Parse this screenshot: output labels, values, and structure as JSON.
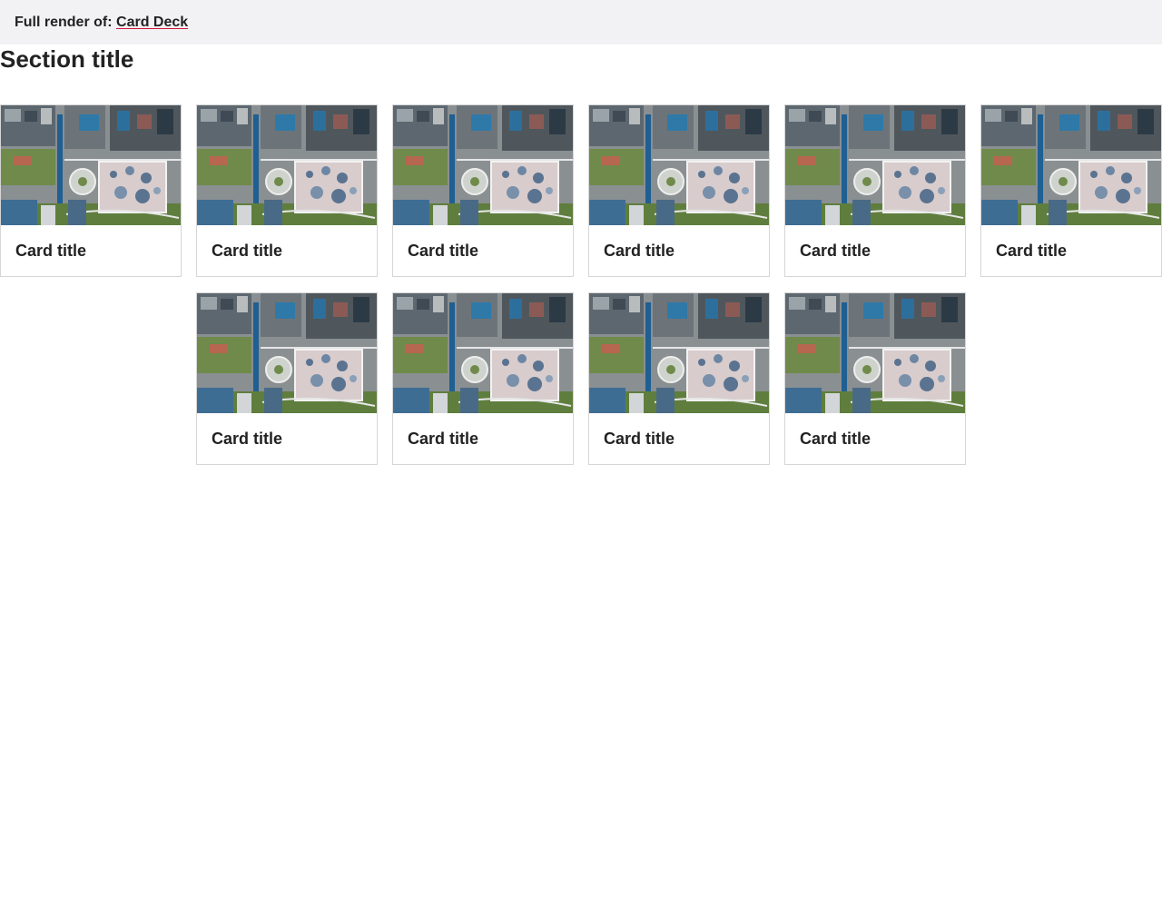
{
  "header": {
    "prefix": "Full render of:",
    "link_label": "Card Deck"
  },
  "section": {
    "title": "Section title"
  },
  "cards": [
    {
      "title": "Card title",
      "image_icon": "aerial-photo"
    },
    {
      "title": "Card title",
      "image_icon": "aerial-photo"
    },
    {
      "title": "Card title",
      "image_icon": "aerial-photo"
    },
    {
      "title": "Card title",
      "image_icon": "aerial-photo"
    },
    {
      "title": "Card title",
      "image_icon": "aerial-photo"
    },
    {
      "title": "Card title",
      "image_icon": "aerial-photo"
    },
    {
      "title": "Card title",
      "image_icon": "aerial-photo"
    },
    {
      "title": "Card title",
      "image_icon": "aerial-photo"
    },
    {
      "title": "Card title",
      "image_icon": "aerial-photo"
    },
    {
      "title": "Card title",
      "image_icon": "aerial-photo"
    }
  ],
  "colors": {
    "topbar_bg": "#f2f2f4",
    "link_underline": "#d0143a",
    "card_border": "#d6d6d6",
    "text": "#222222"
  }
}
